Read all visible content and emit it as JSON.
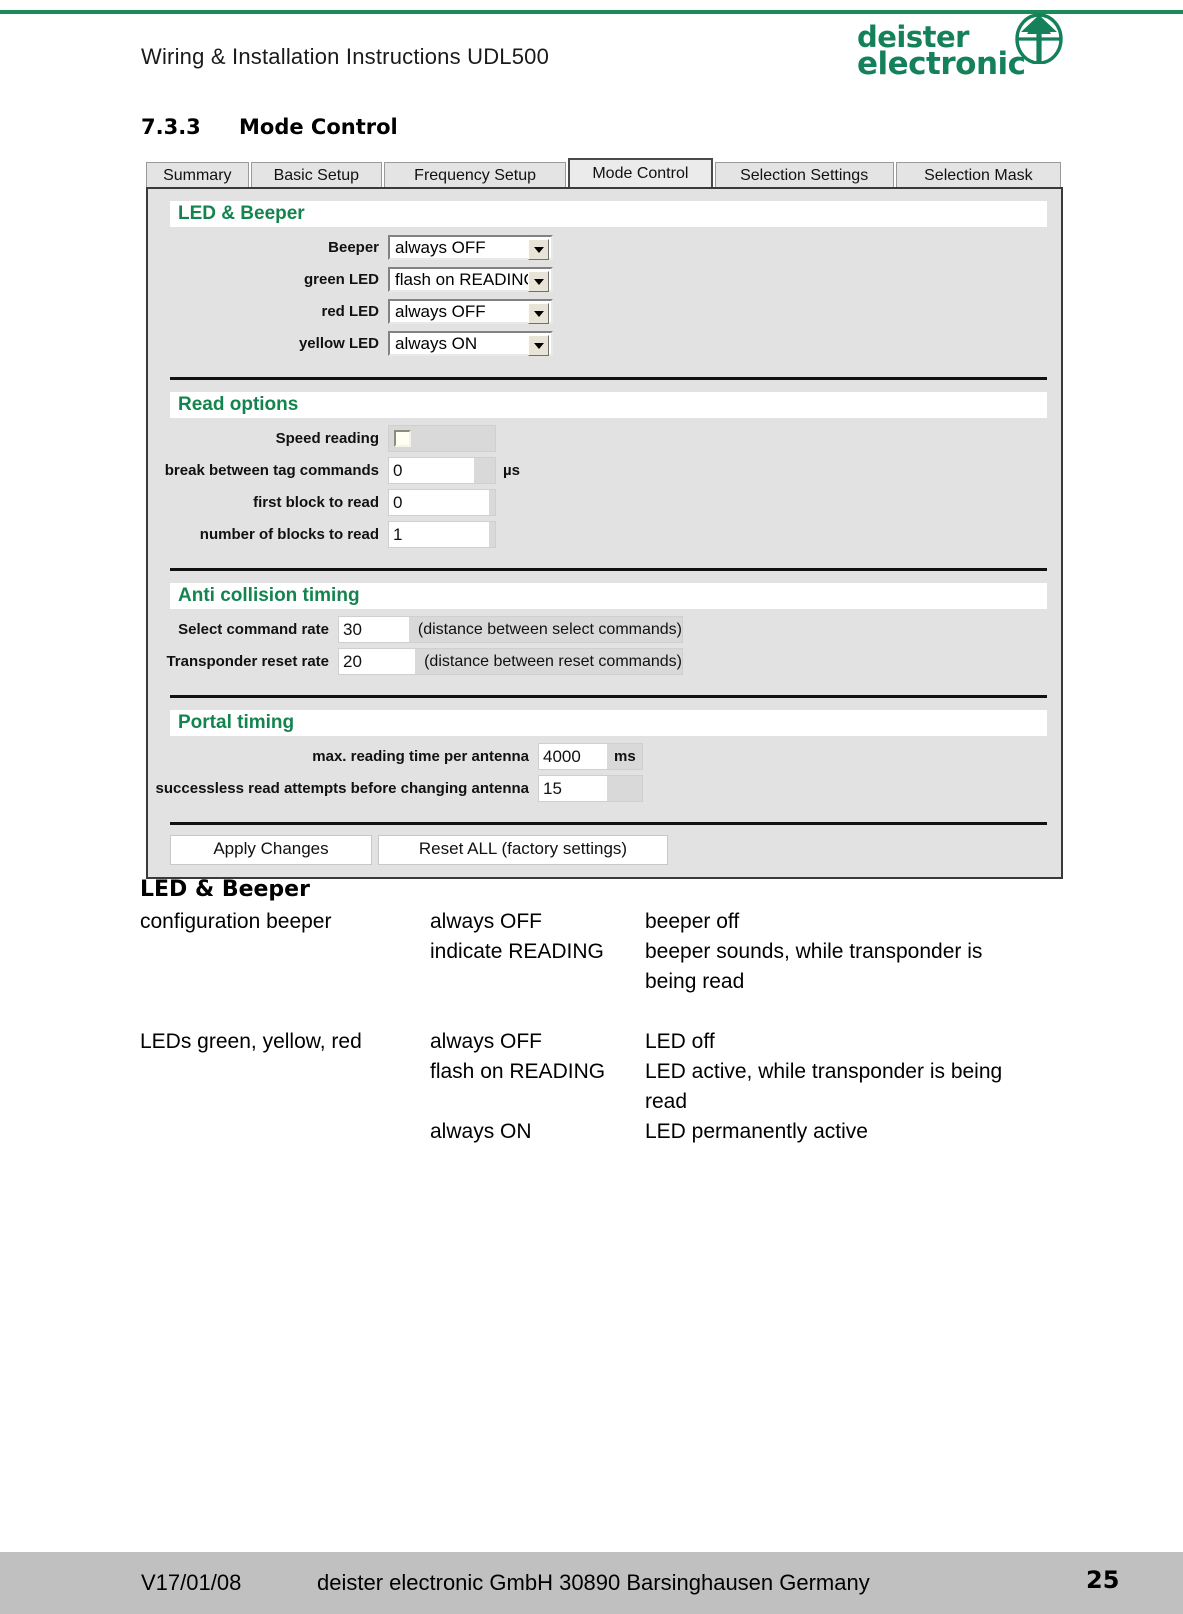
{
  "header": {
    "doc_title": "Wiring & Installation Instructions UDL500",
    "logo_line1": "deister",
    "logo_line2": "electronic",
    "brand_green": "#14815a",
    "rule_green": "#1a8a58"
  },
  "section": {
    "number": "7.3.3",
    "title": "Mode Control"
  },
  "app": {
    "tabs": [
      {
        "label": "Summary",
        "active": false
      },
      {
        "label": "Basic Setup",
        "active": false
      },
      {
        "label": "Frequency Setup",
        "active": false
      },
      {
        "label": "Mode Control",
        "active": true
      },
      {
        "label": "Selection Settings",
        "active": false
      },
      {
        "label": "Selection Mask",
        "active": false
      }
    ],
    "groups": {
      "led_beeper": {
        "title": "LED & Beeper",
        "rows": [
          {
            "label": "Beeper",
            "value": "always OFF"
          },
          {
            "label": "green LED",
            "value": "flash on READING"
          },
          {
            "label": "red LED",
            "value": "always OFF"
          },
          {
            "label": "yellow LED",
            "value": "always ON"
          }
        ]
      },
      "read_options": {
        "title": "Read options",
        "rows": [
          {
            "label": "Speed reading",
            "type": "checkbox",
            "checked": false,
            "value": ""
          },
          {
            "label": "break between tag commands",
            "type": "text",
            "value": "0",
            "unit": "µs"
          },
          {
            "label": "first block to read",
            "type": "text",
            "value": "0",
            "unit": ""
          },
          {
            "label": "number of blocks to read",
            "type": "text",
            "value": "1",
            "unit": ""
          }
        ]
      },
      "anti_collision": {
        "title": "Anti collision timing",
        "rows": [
          {
            "label": "Select command rate",
            "value": "30",
            "hint": "(distance between select commands)"
          },
          {
            "label": "Transponder reset rate",
            "value": "20",
            "hint": "(distance between reset commands)"
          }
        ]
      },
      "portal_timing": {
        "title": "Portal timing",
        "rows": [
          {
            "label": "max. reading time per antenna",
            "value": "4000",
            "unit": "ms"
          },
          {
            "label": "successless read attempts before changing antenna",
            "value": "15",
            "unit": ""
          }
        ]
      }
    },
    "buttons": [
      {
        "label": "Apply Changes"
      },
      {
        "label": "Reset ALL (factory settings)"
      }
    ],
    "accent_green": "#14844f"
  },
  "body": {
    "heading": "LED & Beeper",
    "rows": [
      {
        "term": "configuration beeper",
        "option": "always OFF",
        "desc": "beeper off"
      },
      {
        "term": "",
        "option": "indicate READING",
        "desc": "beeper sounds, while transponder is"
      },
      {
        "term": "",
        "option": "",
        "desc": "being read"
      },
      {
        "term": "LEDs green, yellow, red",
        "option": "always OFF",
        "desc": "LED off"
      },
      {
        "term": "",
        "option": "flash on READING",
        "desc": "LED active, while transponder is being"
      },
      {
        "term": "",
        "option": "",
        "desc": "read"
      },
      {
        "term": "",
        "option": "always ON",
        "desc": "LED permanently active"
      }
    ]
  },
  "footer": {
    "version": "V17/01/08",
    "company": "deister electronic GmbH  30890 Barsinghausen  Germany",
    "page": "25"
  }
}
